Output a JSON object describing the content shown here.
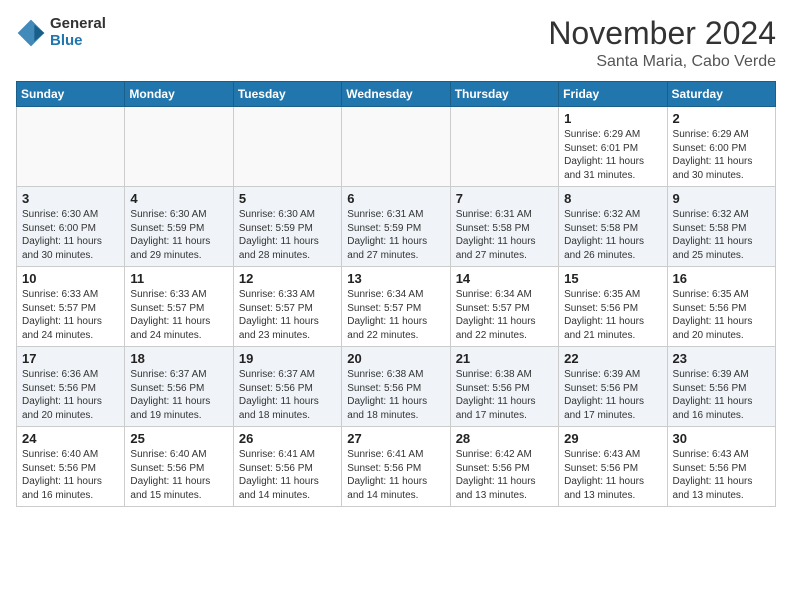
{
  "header": {
    "logo_general": "General",
    "logo_blue": "Blue",
    "month": "November 2024",
    "location": "Santa Maria, Cabo Verde"
  },
  "weekdays": [
    "Sunday",
    "Monday",
    "Tuesday",
    "Wednesday",
    "Thursday",
    "Friday",
    "Saturday"
  ],
  "weeks": [
    [
      {
        "day": "",
        "info": ""
      },
      {
        "day": "",
        "info": ""
      },
      {
        "day": "",
        "info": ""
      },
      {
        "day": "",
        "info": ""
      },
      {
        "day": "",
        "info": ""
      },
      {
        "day": "1",
        "info": "Sunrise: 6:29 AM\nSunset: 6:01 PM\nDaylight: 11 hours\nand 31 minutes."
      },
      {
        "day": "2",
        "info": "Sunrise: 6:29 AM\nSunset: 6:00 PM\nDaylight: 11 hours\nand 30 minutes."
      }
    ],
    [
      {
        "day": "3",
        "info": "Sunrise: 6:30 AM\nSunset: 6:00 PM\nDaylight: 11 hours\nand 30 minutes."
      },
      {
        "day": "4",
        "info": "Sunrise: 6:30 AM\nSunset: 5:59 PM\nDaylight: 11 hours\nand 29 minutes."
      },
      {
        "day": "5",
        "info": "Sunrise: 6:30 AM\nSunset: 5:59 PM\nDaylight: 11 hours\nand 28 minutes."
      },
      {
        "day": "6",
        "info": "Sunrise: 6:31 AM\nSunset: 5:59 PM\nDaylight: 11 hours\nand 27 minutes."
      },
      {
        "day": "7",
        "info": "Sunrise: 6:31 AM\nSunset: 5:58 PM\nDaylight: 11 hours\nand 27 minutes."
      },
      {
        "day": "8",
        "info": "Sunrise: 6:32 AM\nSunset: 5:58 PM\nDaylight: 11 hours\nand 26 minutes."
      },
      {
        "day": "9",
        "info": "Sunrise: 6:32 AM\nSunset: 5:58 PM\nDaylight: 11 hours\nand 25 minutes."
      }
    ],
    [
      {
        "day": "10",
        "info": "Sunrise: 6:33 AM\nSunset: 5:57 PM\nDaylight: 11 hours\nand 24 minutes."
      },
      {
        "day": "11",
        "info": "Sunrise: 6:33 AM\nSunset: 5:57 PM\nDaylight: 11 hours\nand 24 minutes."
      },
      {
        "day": "12",
        "info": "Sunrise: 6:33 AM\nSunset: 5:57 PM\nDaylight: 11 hours\nand 23 minutes."
      },
      {
        "day": "13",
        "info": "Sunrise: 6:34 AM\nSunset: 5:57 PM\nDaylight: 11 hours\nand 22 minutes."
      },
      {
        "day": "14",
        "info": "Sunrise: 6:34 AM\nSunset: 5:57 PM\nDaylight: 11 hours\nand 22 minutes."
      },
      {
        "day": "15",
        "info": "Sunrise: 6:35 AM\nSunset: 5:56 PM\nDaylight: 11 hours\nand 21 minutes."
      },
      {
        "day": "16",
        "info": "Sunrise: 6:35 AM\nSunset: 5:56 PM\nDaylight: 11 hours\nand 20 minutes."
      }
    ],
    [
      {
        "day": "17",
        "info": "Sunrise: 6:36 AM\nSunset: 5:56 PM\nDaylight: 11 hours\nand 20 minutes."
      },
      {
        "day": "18",
        "info": "Sunrise: 6:37 AM\nSunset: 5:56 PM\nDaylight: 11 hours\nand 19 minutes."
      },
      {
        "day": "19",
        "info": "Sunrise: 6:37 AM\nSunset: 5:56 PM\nDaylight: 11 hours\nand 18 minutes."
      },
      {
        "day": "20",
        "info": "Sunrise: 6:38 AM\nSunset: 5:56 PM\nDaylight: 11 hours\nand 18 minutes."
      },
      {
        "day": "21",
        "info": "Sunrise: 6:38 AM\nSunset: 5:56 PM\nDaylight: 11 hours\nand 17 minutes."
      },
      {
        "day": "22",
        "info": "Sunrise: 6:39 AM\nSunset: 5:56 PM\nDaylight: 11 hours\nand 17 minutes."
      },
      {
        "day": "23",
        "info": "Sunrise: 6:39 AM\nSunset: 5:56 PM\nDaylight: 11 hours\nand 16 minutes."
      }
    ],
    [
      {
        "day": "24",
        "info": "Sunrise: 6:40 AM\nSunset: 5:56 PM\nDaylight: 11 hours\nand 16 minutes."
      },
      {
        "day": "25",
        "info": "Sunrise: 6:40 AM\nSunset: 5:56 PM\nDaylight: 11 hours\nand 15 minutes."
      },
      {
        "day": "26",
        "info": "Sunrise: 6:41 AM\nSunset: 5:56 PM\nDaylight: 11 hours\nand 14 minutes."
      },
      {
        "day": "27",
        "info": "Sunrise: 6:41 AM\nSunset: 5:56 PM\nDaylight: 11 hours\nand 14 minutes."
      },
      {
        "day": "28",
        "info": "Sunrise: 6:42 AM\nSunset: 5:56 PM\nDaylight: 11 hours\nand 13 minutes."
      },
      {
        "day": "29",
        "info": "Sunrise: 6:43 AM\nSunset: 5:56 PM\nDaylight: 11 hours\nand 13 minutes."
      },
      {
        "day": "30",
        "info": "Sunrise: 6:43 AM\nSunset: 5:56 PM\nDaylight: 11 hours\nand 13 minutes."
      }
    ]
  ]
}
